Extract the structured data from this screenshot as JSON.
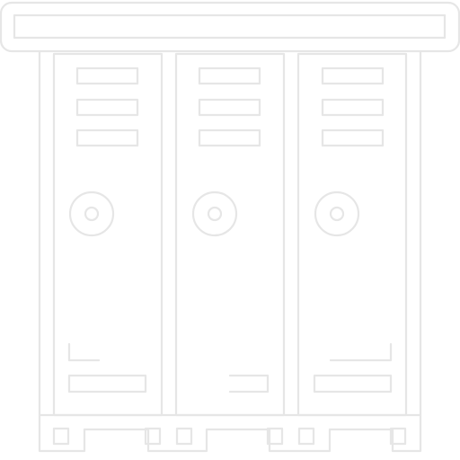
{
  "icon": {
    "name": "lockers-icon",
    "stroke_color": "#e6e6e6",
    "background_color": "#ffffff",
    "locker_count": 3
  }
}
